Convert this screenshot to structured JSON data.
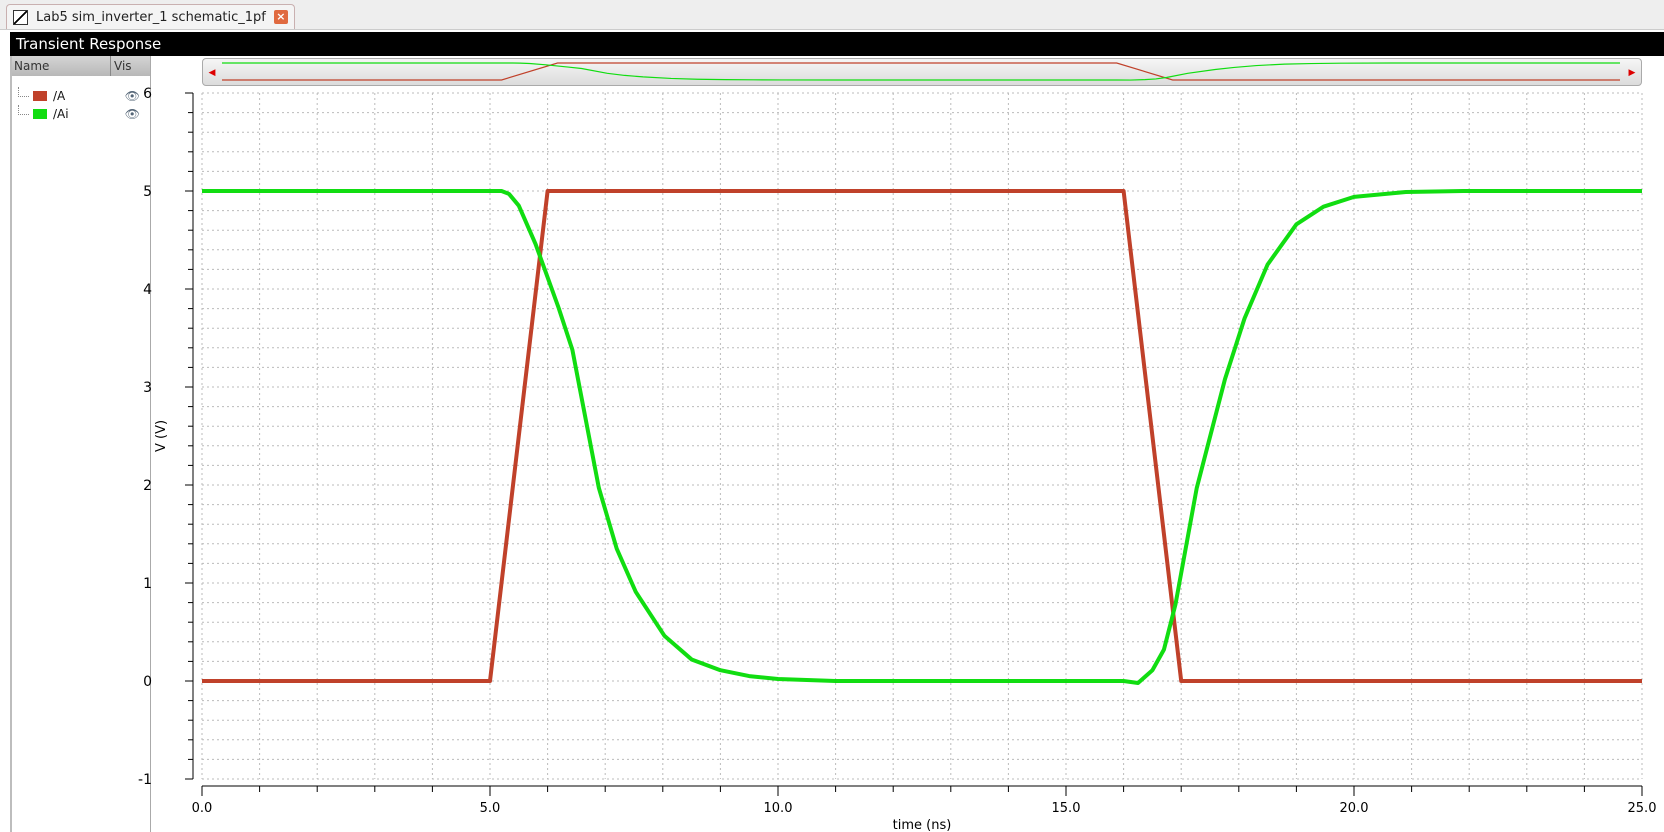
{
  "window": {
    "tab_title": "Lab5 sim_inverter_1 schematic_1pf",
    "panel_title": "Transient Response"
  },
  "legend": {
    "col_name": "Name",
    "col_vis": "Vis",
    "items": [
      {
        "label": "/A",
        "color": "#c0412a"
      },
      {
        "label": "/Ai",
        "color": "#11dd11"
      }
    ]
  },
  "chart_data": {
    "type": "line",
    "xlabel": "time (ns)",
    "ylabel": "V (V)",
    "xlim": [
      0,
      25
    ],
    "ylim": [
      -1,
      6
    ],
    "xticks": [
      "0.0",
      "5.0",
      "10.0",
      "15.0",
      "20.0",
      "25.0"
    ],
    "yticks": [
      "-1",
      "0",
      "1",
      "2",
      "3",
      "4",
      "5",
      "6"
    ],
    "grid": true,
    "series": [
      {
        "name": "/A",
        "color": "#c0412a",
        "x": [
          0,
          5,
          6,
          16,
          17,
          25
        ],
        "y": [
          0,
          0,
          5,
          5,
          0,
          0
        ]
      },
      {
        "name": "/Ai",
        "color": "#11dd11",
        "x": [
          0,
          5,
          5.2,
          5.33,
          5.5,
          5.79,
          6.19,
          6.43,
          6.89,
          7.2,
          7.53,
          8.03,
          8.5,
          9.0,
          9.5,
          10,
          11,
          16,
          16.25,
          16.5,
          16.7,
          16.9,
          17.27,
          17.76,
          18.1,
          18.5,
          19.0,
          19.47,
          20.0,
          20.9,
          21.9,
          25
        ],
        "y": [
          5,
          5,
          5,
          4.97,
          4.85,
          4.46,
          3.81,
          3.38,
          1.97,
          1.35,
          0.91,
          0.46,
          0.22,
          0.11,
          0.05,
          0.02,
          0,
          0,
          -0.02,
          0.11,
          0.32,
          0.78,
          1.97,
          3.08,
          3.7,
          4.25,
          4.66,
          4.84,
          4.94,
          4.99,
          5,
          5
        ]
      }
    ]
  }
}
